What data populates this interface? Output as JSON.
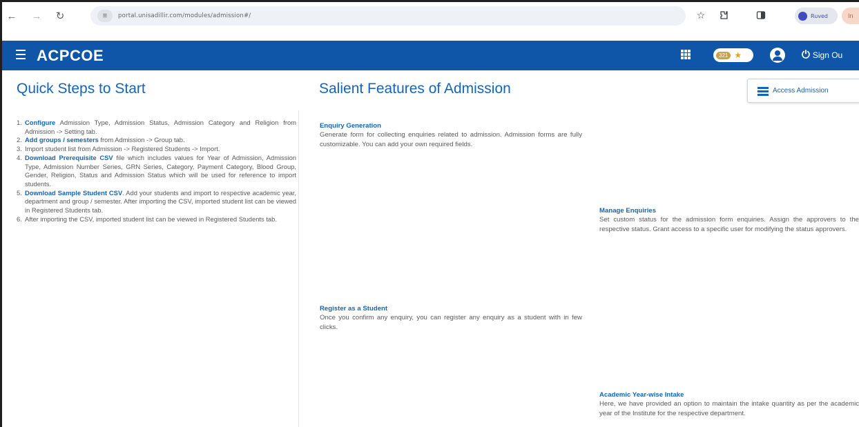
{
  "browser": {
    "url": "portal.unisadillir.com/modules/admission#/",
    "profile_label": "Ruved",
    "avatar_label": "In"
  },
  "header": {
    "title": "ACPCOE",
    "badge_count": "321",
    "signout_label": "Sign Ou"
  },
  "quick_steps": {
    "title": "Quick Steps to Start",
    "items": [
      {
        "num": "1.",
        "link": "Configure",
        "text": " Admission Type, Admission Status, Admission Category and Religion from Admission -> Setting tab."
      },
      {
        "num": "2.",
        "link": "Add groups / semesters",
        "text": " from Admission -> Group tab."
      },
      {
        "num": "3.",
        "link": "",
        "text": "Import student list from Admission -> Registered Students -> Import."
      },
      {
        "num": "4.",
        "link": "Download Prerequisite CSV",
        "text": " file which includes values for Year of Admission, Admission Type, Admission Number Series, GRN Series, Category, Payment Category, Blood Group, Gender, Religion, Status and Admission Status which will be used for reference to import students."
      },
      {
        "num": "5.",
        "link": "Download Sample Student CSV",
        "text": ". Add your students and import to respective academic year, department and group / semester. After importing the CSV, imported student list can be viewed in Registered Students tab."
      },
      {
        "num": "6.",
        "link": "",
        "text": "After importing the CSV, imported student list can be viewed in Registered Students tab."
      }
    ]
  },
  "features": {
    "title": "Salient Features of Admission",
    "access_button_label": "Access Admission",
    "items": [
      {
        "title": "Enquiry Generation",
        "text": "Generate form for collecting enquiries related to admission. Admission forms are fully customizable. You can add your own required fields."
      },
      {
        "title": "Manage Enquiries",
        "text": "Set custom status for the admission form enquiries. Assign the approvers to the respective status. Grant access to a specific user for modifying the status approvers."
      },
      {
        "title": "Register as a Student",
        "text": "Once you confirm any enquiry, you can register any enquiry as a student with in few clicks."
      },
      {
        "title": "Academic Year-wise Intake",
        "text": "Here, we have provided an option to maintain the intake quantity as per the academic year of the Institute for the respective department."
      }
    ]
  },
  "icons": {
    "back": "back-arrow-icon",
    "forward": "forward-arrow-icon",
    "reload": "reload-icon",
    "star": "bookmark-star-icon",
    "extensions": "extensions-icon",
    "sidepanel": "side-panel-icon",
    "menu": "hamburger-menu-icon",
    "apps": "apps-grid-icon",
    "trophy": "trophy-icon",
    "user": "user-account-icon",
    "power": "power-icon",
    "access": "access-admission-icon"
  },
  "colors": {
    "header_bg": "#0f56a8",
    "accent": "#1565b6",
    "text": "#5a5a5a"
  }
}
